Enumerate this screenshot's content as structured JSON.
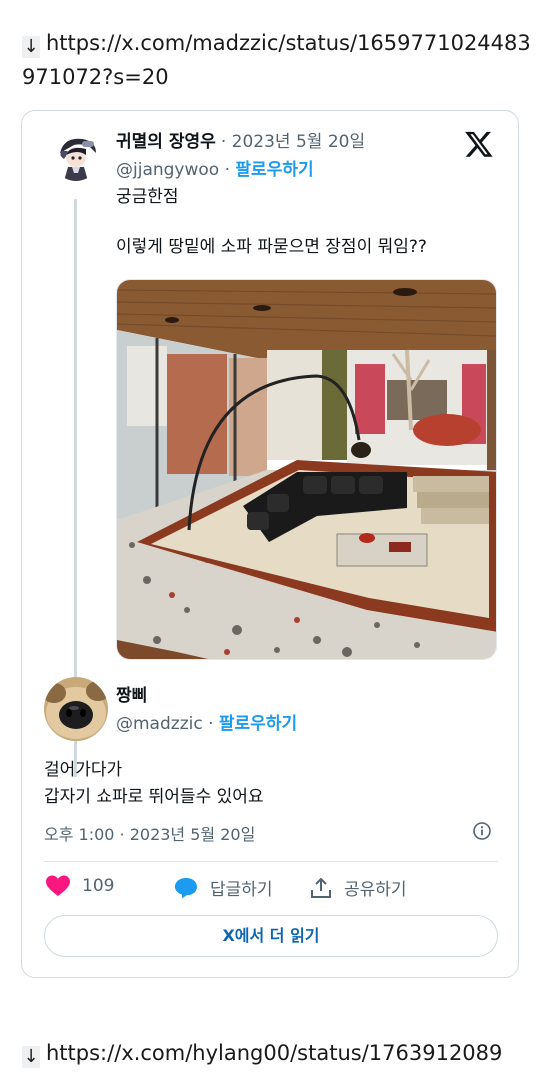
{
  "links": {
    "top": "https://x.com/madzzic/status/1659771024483971072?s=20",
    "bottom": "https://x.com/hylang00/status/1763912089"
  },
  "tweet": {
    "author_name": "귀멸의 장영우",
    "date": "· 2023년 5월 20일",
    "handle": "@jjangywoo",
    "follow_label": "팔로우하기",
    "text": "궁금한점\n\n이렇게 땅밑에 소파 파묻으면 장점이 뭐임??"
  },
  "reply": {
    "author_name": "짱삐",
    "handle": "@madzzic",
    "follow_label": "팔로우하기",
    "text": "걸어가다가\n갑자기 쇼파로 뛰어들수 있어요",
    "timestamp": "오후 1:00 · 2023년 5월 20일"
  },
  "actions": {
    "like_count": "109",
    "reply_label": "답글하기",
    "share_label": "공유하기"
  },
  "read_more_label": "X에서 더 읽기",
  "colors": {
    "accent": "#1d9bf0",
    "like": "#f91880",
    "text": "#0f1419",
    "muted": "#536471",
    "border": "#cfd9de"
  },
  "icons": [
    "down-arrow-icon",
    "x-logo-icon",
    "heart-icon",
    "reply-bubble-icon",
    "share-icon",
    "info-icon"
  ]
}
